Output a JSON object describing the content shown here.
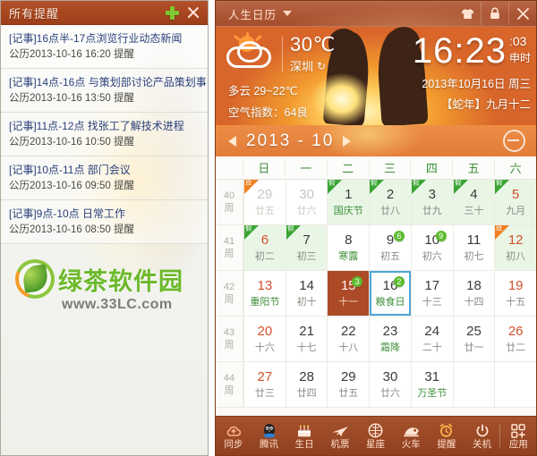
{
  "reminder_panel": {
    "title": "所有提醒",
    "add_icon": "plus-icon",
    "close_icon": "close-icon",
    "items": [
      {
        "title": "[记事]16点半-17点浏览行业动态新闻",
        "sub": "公历2013-10-16  16:20  提醒"
      },
      {
        "title": "[记事]14点-16点  与策划部讨论产品策划事",
        "sub": "公历2013-10-16  13:50  提醒"
      },
      {
        "title": "[记事]11点-12点  找张工了解技术进程",
        "sub": "公历2013-10-16  10:50  提醒"
      },
      {
        "title": "[记事]10点-11点  部门会议",
        "sub": "公历2013-10-16  09:50  提醒"
      },
      {
        "title": "[记事]9点-10点  日常工作",
        "sub": "公历2013-10-16  08:50  提醒"
      }
    ],
    "watermark": {
      "name": "绿茶软件园",
      "url": "www.33LC.com"
    }
  },
  "calendar_window": {
    "title": "人生日历",
    "caret_icon": "chevron-down-icon",
    "buttons": [
      {
        "name": "skin-icon",
        "label": "换肤"
      },
      {
        "name": "lock-icon",
        "label": "锁定"
      },
      {
        "name": "close-icon",
        "label": "关闭"
      }
    ],
    "weather": {
      "icon": "sun-cloud-icon",
      "temp": "30℃",
      "city": "深圳",
      "refresh_icon": "refresh-icon",
      "condition_range": "多云 29~22℃",
      "air": "空气指数：64良"
    },
    "clock": {
      "hm": "16:23",
      "seconds": "03",
      "shichen": "申时",
      "date": "2013年10月16日  周三",
      "lunar": "【蛇年】九月十二"
    },
    "month_bar": {
      "prev_icon": "chevron-left-icon",
      "next_icon": "chevron-right-icon",
      "label": "2013 - 10",
      "today_icon": "back-to-today-icon"
    },
    "week_headers": [
      "日",
      "一",
      "二",
      "三",
      "四",
      "五",
      "六"
    ],
    "week_suffix": "周",
    "grid": [
      {
        "week": "40",
        "days": [
          {
            "num": "29",
            "lunar": "廿五",
            "other_month": true,
            "corner": "班",
            "corner_type": "work"
          },
          {
            "num": "30",
            "lunar": "廿六",
            "other_month": true
          },
          {
            "num": "1",
            "lunar": "国庆节",
            "lunar_style": "festival",
            "holiday": true,
            "corner": "假",
            "corner_type": "rest"
          },
          {
            "num": "2",
            "lunar": "廿八",
            "holiday": true,
            "corner": "假",
            "corner_type": "rest"
          },
          {
            "num": "3",
            "lunar": "廿九",
            "holiday": true,
            "corner": "假",
            "corner_type": "rest"
          },
          {
            "num": "4",
            "lunar": "三十",
            "holiday": true,
            "corner": "假",
            "corner_type": "rest"
          },
          {
            "num": "5",
            "lunar": "九月",
            "num_style": "red",
            "holiday": true,
            "corner": "假",
            "corner_type": "rest"
          }
        ]
      },
      {
        "week": "41",
        "days": [
          {
            "num": "6",
            "lunar": "初二",
            "num_style": "red",
            "holiday": true,
            "corner": "假",
            "corner_type": "rest"
          },
          {
            "num": "7",
            "lunar": "初三",
            "holiday": true,
            "corner": "假",
            "corner_type": "rest"
          },
          {
            "num": "8",
            "lunar": "寒露",
            "lunar_style": "term"
          },
          {
            "num": "9",
            "lunar": "初五",
            "badge": "6"
          },
          {
            "num": "10",
            "lunar": "初六",
            "badge": "9"
          },
          {
            "num": "11",
            "lunar": "初七"
          },
          {
            "num": "12",
            "lunar": "初八",
            "num_style": "red",
            "holiday": true,
            "corner": "班",
            "corner_type": "work"
          }
        ]
      },
      {
        "week": "42",
        "days": [
          {
            "num": "13",
            "lunar": "重阳节",
            "num_style": "red",
            "lunar_style": "festival"
          },
          {
            "num": "14",
            "lunar": "初十"
          },
          {
            "num": "15",
            "lunar": "十一",
            "selected": true,
            "badge": "3"
          },
          {
            "num": "16",
            "lunar": "粮食日",
            "lunar_style": "festival",
            "today": true,
            "badge": "2"
          },
          {
            "num": "17",
            "lunar": "十三"
          },
          {
            "num": "18",
            "lunar": "十四"
          },
          {
            "num": "19",
            "lunar": "十五",
            "num_style": "red"
          }
        ]
      },
      {
        "week": "43",
        "days": [
          {
            "num": "20",
            "lunar": "十六",
            "num_style": "red"
          },
          {
            "num": "21",
            "lunar": "十七"
          },
          {
            "num": "22",
            "lunar": "十八"
          },
          {
            "num": "23",
            "lunar": "霜降",
            "lunar_style": "term"
          },
          {
            "num": "24",
            "lunar": "二十"
          },
          {
            "num": "25",
            "lunar": "廿一"
          },
          {
            "num": "26",
            "lunar": "廿二",
            "num_style": "red"
          }
        ]
      },
      {
        "week": "44",
        "days": [
          {
            "num": "27",
            "lunar": "廿三",
            "num_style": "red"
          },
          {
            "num": "28",
            "lunar": "廿四"
          },
          {
            "num": "29",
            "lunar": "廿五"
          },
          {
            "num": "30",
            "lunar": "廿六"
          },
          {
            "num": "31",
            "lunar": "万圣节",
            "lunar_style": "festival"
          },
          {
            "num": "",
            "lunar": "",
            "empty": true
          },
          {
            "num": "",
            "lunar": "",
            "empty": true
          }
        ]
      }
    ],
    "toolbar": [
      {
        "label": "同步",
        "icon": "cloud-sync-icon"
      },
      {
        "label": "腾讯",
        "icon": "qq-penguin-icon"
      },
      {
        "label": "生日",
        "icon": "birthday-cake-icon"
      },
      {
        "label": "机票",
        "icon": "airplane-icon"
      },
      {
        "label": "星座",
        "icon": "zodiac-globe-icon"
      },
      {
        "label": "火车",
        "icon": "train-icon"
      },
      {
        "label": "提醒",
        "icon": "alarm-clock-icon"
      },
      {
        "label": "关机",
        "icon": "power-icon"
      },
      {
        "label": "应用",
        "icon": "apps-grid-icon"
      }
    ]
  },
  "colors": {
    "brand_brown": "#a34e2d",
    "accent_orange": "#e0712a",
    "holiday_green": "#3aa535",
    "work_orange": "#f0801f",
    "today_blue": "#4aa7d8",
    "selected_bg": "#ad4a27",
    "badge_green": "#5dbb2e"
  }
}
